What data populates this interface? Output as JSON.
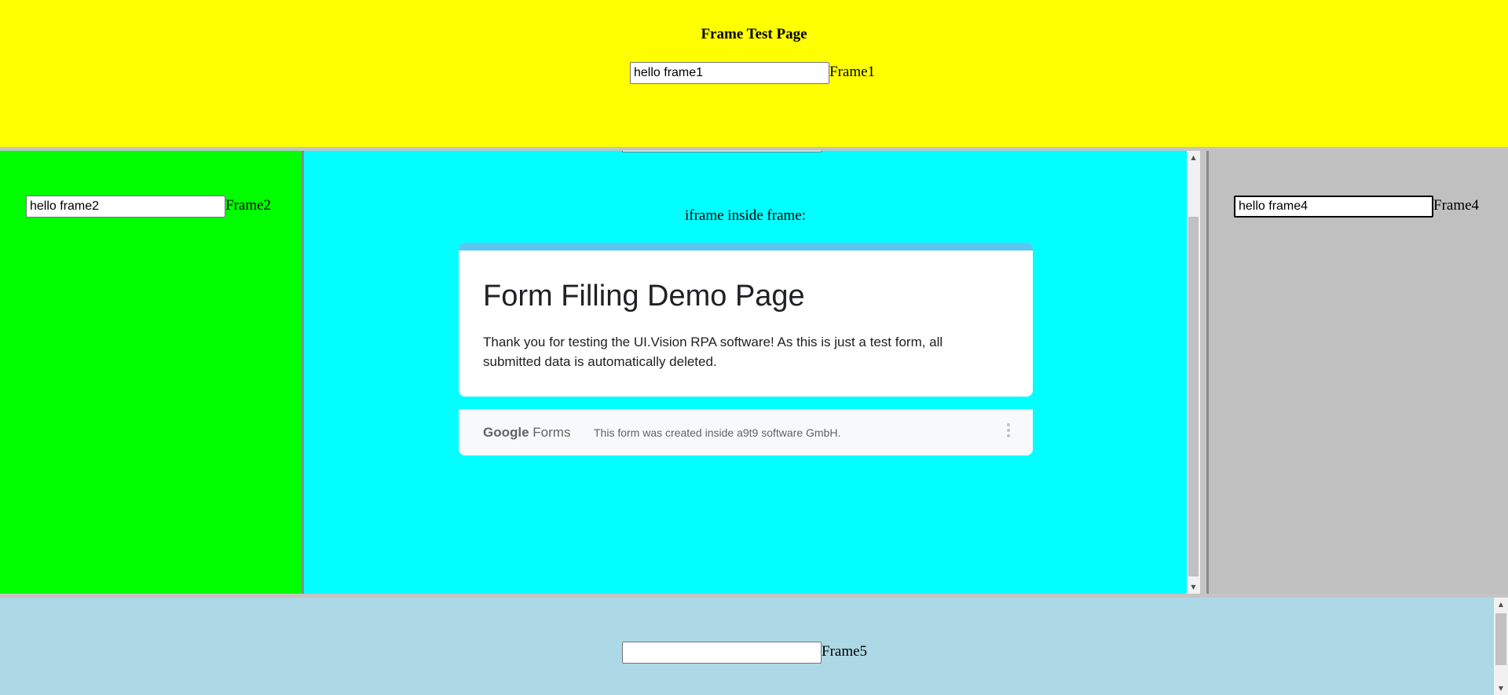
{
  "frame1": {
    "title": "Frame Test Page",
    "input_value": "hello frame1",
    "label": "Frame1"
  },
  "frame2": {
    "input_value": "hello frame2",
    "label": "Frame2"
  },
  "frame3": {
    "caption": "iframe inside frame:",
    "form": {
      "title": "Form Filling Demo Page",
      "description": "Thank you for testing the UI.Vision RPA software! As this is just a test form, all submitted data is automatically deleted.",
      "footer_logo_google": "Google",
      "footer_logo_forms": "Forms",
      "footer_note": "This form was created inside a9t9 software GmbH."
    }
  },
  "frame4": {
    "input_value": "hello frame4",
    "label": "Frame4"
  },
  "frame5": {
    "input_value": "",
    "label": "Frame5"
  },
  "colors": {
    "frame1_bg": "#ffff00",
    "frame2_bg": "#00ff00",
    "frame3_bg": "#00ffff",
    "frame4_bg": "#c0c0c0",
    "frame5_bg": "#add8e6",
    "form_accent": "#5cc6f0"
  },
  "icons": {
    "scroll_up": "scroll-up-arrow",
    "scroll_down": "scroll-down-arrow",
    "more": "more-vert-icon"
  }
}
